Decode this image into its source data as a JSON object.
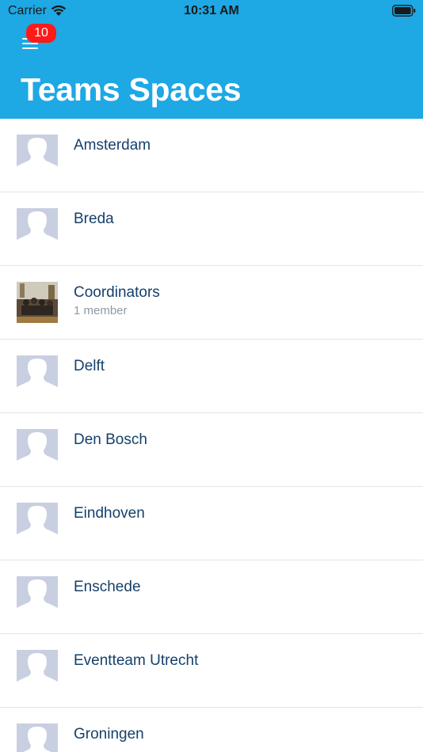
{
  "status_bar": {
    "carrier": "Carrier",
    "time": "10:31 AM"
  },
  "header": {
    "title": "Teams Spaces",
    "badge_count": "10"
  },
  "spaces": [
    {
      "name": "Amsterdam",
      "subtitle": "",
      "avatar": "placeholder"
    },
    {
      "name": "Breda",
      "subtitle": "",
      "avatar": "placeholder"
    },
    {
      "name": "Coordinators",
      "subtitle": "1 member",
      "avatar": "photo"
    },
    {
      "name": "Delft",
      "subtitle": "",
      "avatar": "placeholder"
    },
    {
      "name": "Den Bosch",
      "subtitle": "",
      "avatar": "placeholder"
    },
    {
      "name": "Eindhoven",
      "subtitle": "",
      "avatar": "placeholder"
    },
    {
      "name": "Enschede",
      "subtitle": "",
      "avatar": "placeholder"
    },
    {
      "name": "Eventteam Utrecht",
      "subtitle": "",
      "avatar": "placeholder"
    },
    {
      "name": "Groningen",
      "subtitle": "",
      "avatar": "placeholder"
    }
  ],
  "colors": {
    "header_bg": "#1ea8e4",
    "badge_bg": "#ff1a1a",
    "name_text": "#15406b",
    "avatar_placeholder": "#c8cfe0"
  },
  "icons": {
    "menu": "hamburger-menu-icon",
    "wifi": "wifi-icon",
    "battery": "battery-icon",
    "avatar": "person-silhouette-icon"
  }
}
